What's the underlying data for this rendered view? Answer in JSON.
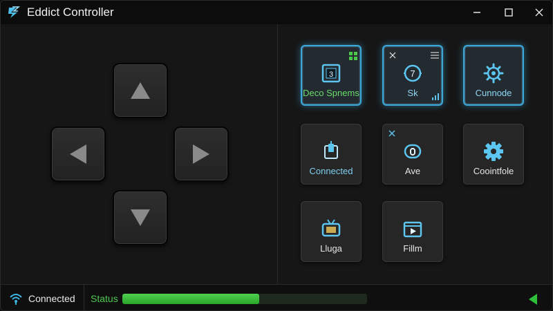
{
  "window": {
    "title": "Eddict Controller",
    "logo_icon": "lightning-s-icon",
    "controls": [
      "minimize-icon",
      "maximize-icon",
      "close-icon"
    ]
  },
  "dpad": {
    "buttons": [
      "up-arrow-icon",
      "left-arrow-icon",
      "right-arrow-icon",
      "down-arrow-icon"
    ]
  },
  "tiles": [
    {
      "label": "Deco Spnems",
      "icon": "monitor-3-icon",
      "active": true,
      "corner_icon": "grid-icon"
    },
    {
      "label": "Sk",
      "icon": "dial-7-icon",
      "active": true,
      "corner_icon": "menu-icon"
    },
    {
      "label": "Cunnode",
      "icon": "gear-outline-icon",
      "active": true
    },
    {
      "label": "Connected",
      "icon": "connector-icon",
      "active": false
    },
    {
      "label": "Ave",
      "icon": "capsule-icon",
      "active": false,
      "corner_icon": "close-icon"
    },
    {
      "label": "Coointfole",
      "icon": "gear-icon",
      "active": false
    },
    {
      "label": "Lluga",
      "icon": "tv-icon",
      "active": false
    },
    {
      "label": "Fillm",
      "icon": "film-play-icon",
      "active": false
    }
  ],
  "statusbar": {
    "connection": "Connected",
    "status_label": "Status",
    "progress": 0.56,
    "arrow_icon": "play-back-icon"
  },
  "colors": {
    "accent": "#3aa7d8",
    "status_green": "#4cc94c",
    "background": "#161616"
  }
}
